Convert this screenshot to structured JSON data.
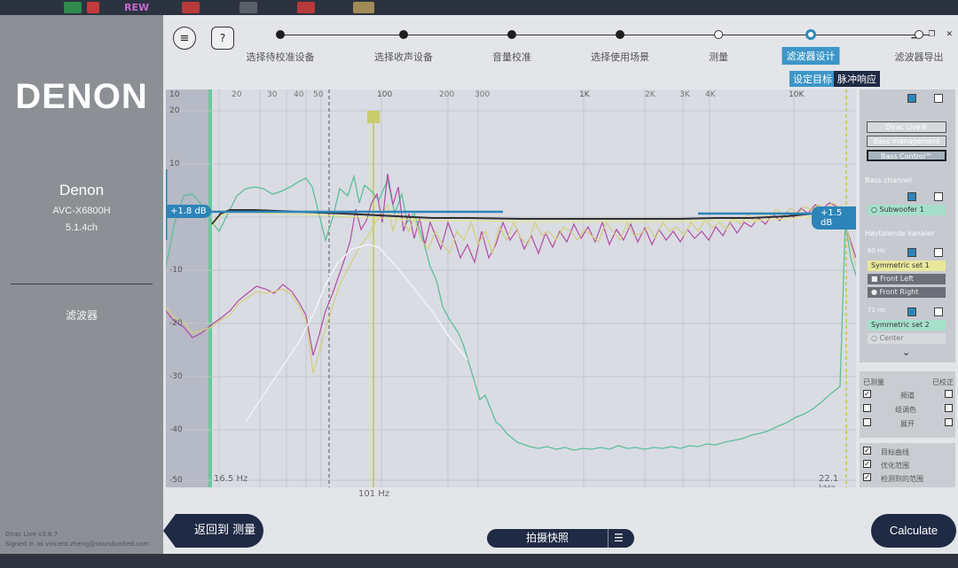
{
  "taskbar": {
    "rew_label": "REW"
  },
  "sidebar": {
    "logo": "DENON",
    "device_name": "Denon",
    "device_model": "AVC-X6800H",
    "channels": "5.1.4ch",
    "section": "滤波器",
    "version": "Dirac Live v3.8.7",
    "signed_in": "Signed in as vincent.zheng@soundunited.com"
  },
  "header": {
    "menu_icon": "hamburger-icon",
    "help_label": "?",
    "steps": [
      {
        "label": "选择待校准设备",
        "state": "done"
      },
      {
        "label": "选择收声设备",
        "state": "done"
      },
      {
        "label": "音量校准",
        "state": "done"
      },
      {
        "label": "选择使用场景",
        "state": "done"
      },
      {
        "label": "测量",
        "state": "todo"
      },
      {
        "label": "滤波器设计",
        "state": "active"
      },
      {
        "label": "滤波器导出",
        "state": "todo"
      }
    ],
    "subtabs": [
      {
        "label": "设定目标",
        "active": true
      },
      {
        "label": "脉冲响应",
        "active": false
      }
    ]
  },
  "graph": {
    "x_ticks": [
      "10",
      "20",
      "30",
      "40",
      "50",
      "100",
      "200",
      "300",
      "1K",
      "2K",
      "3K",
      "4K",
      "10K"
    ],
    "y_ticks": [
      "20",
      "10",
      "-10",
      "-20",
      "-30",
      "-40",
      "-50"
    ],
    "left_gain": "+1.8 dB",
    "right_gain": "+1.5 dB",
    "low_freq_label": "16.5 Hz",
    "high_freq_label": "22.1 kHz",
    "marker_freq": "101 Hz",
    "colors": {
      "front_left": "#b44aa4",
      "front_right": "#d3cf7a",
      "subwoofer": "#5cbf9a",
      "target": "#2e2e2e"
    }
  },
  "right_panel": {
    "dirac_live": "Dirac Live®",
    "bass_management": "Bass management",
    "bass_control": "Bass Control™",
    "bass_channel_heading": "Bass channel",
    "subwoofer": "Subwoofer 1",
    "group_heading": "Høvtalende kanaler",
    "set1_freq": "80 Hz",
    "set1": "Symmetric set 1",
    "front_left": "Front Left",
    "front_right": "Front Right",
    "set2_freq": "71 Hz",
    "set2": "Symmetric set 2",
    "center": "Center"
  },
  "legend": {
    "measured": "已测量",
    "corrected": "已校正",
    "rows": [
      {
        "label": "频道",
        "left_checked": true,
        "right_checked": false
      },
      {
        "label": "组调色",
        "left_checked": false,
        "right_checked": false
      },
      {
        "label": "展开",
        "left_checked": false,
        "right_checked": false
      }
    ],
    "options": [
      {
        "label": "目标曲线",
        "checked": true
      },
      {
        "label": "优化范围",
        "checked": true
      },
      {
        "label": "检测到的范围",
        "checked": true
      }
    ]
  },
  "footer": {
    "back_label": "返回到 测量",
    "snapshot_label": "拍摄快照",
    "calculate_label": "Calculate"
  }
}
